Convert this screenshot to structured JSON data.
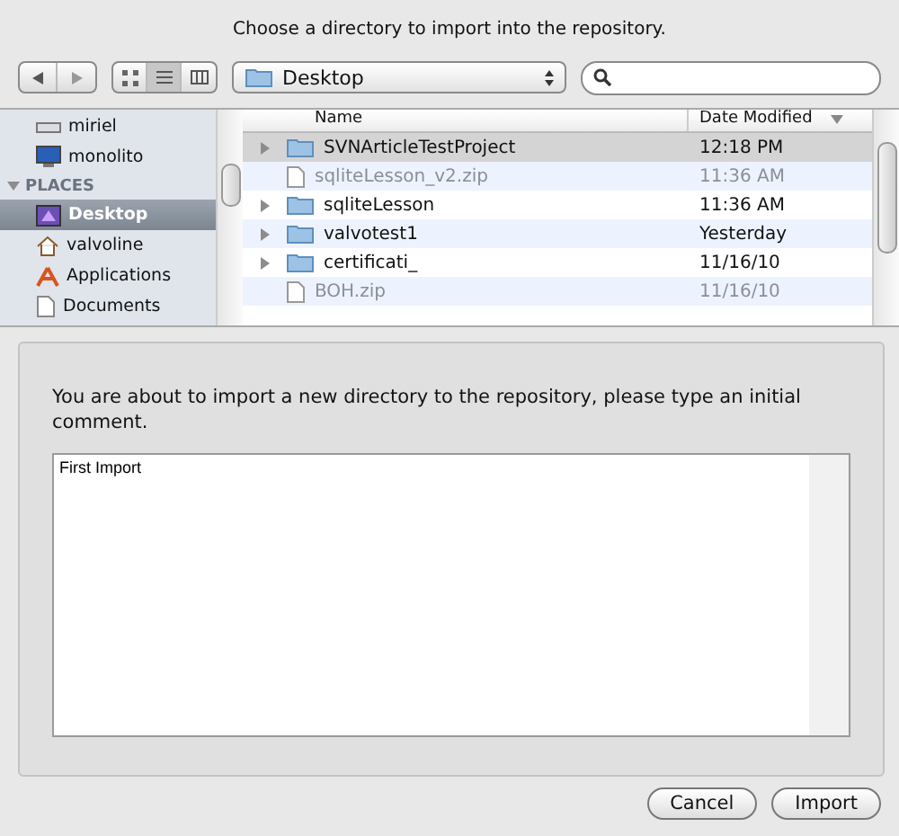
{
  "prompt": "Choose a directory to import into the repository.",
  "toolbar": {
    "views": [
      {
        "kind": "icons",
        "selected": false
      },
      {
        "kind": "list",
        "selected": true
      },
      {
        "kind": "columns",
        "selected": false
      }
    ],
    "location": "Desktop"
  },
  "sidebar": {
    "items": [
      {
        "kind": "drive",
        "label": "miriel",
        "selected": false
      },
      {
        "kind": "monitor",
        "label": "monolito",
        "selected": false
      },
      {
        "kind": "section",
        "label": "PLACES",
        "expanded": true
      },
      {
        "kind": "desktop",
        "label": "Desktop",
        "selected": true
      },
      {
        "kind": "home",
        "label": "valvoline",
        "selected": false
      },
      {
        "kind": "apps",
        "label": "Applications",
        "selected": false
      },
      {
        "kind": "doc",
        "label": "Documents",
        "selected": false
      }
    ]
  },
  "files": {
    "columns": [
      "Name",
      "Date Modified"
    ],
    "rows": [
      {
        "kind": "folder",
        "name": "SVNArticleTestProject",
        "date": "12:18 PM",
        "selected": true,
        "disabled": false
      },
      {
        "kind": "file",
        "name": "sqliteLesson_v2.zip",
        "date": "11:36 AM",
        "selected": false,
        "disabled": true
      },
      {
        "kind": "folder",
        "name": "sqliteLesson",
        "date": "11:36 AM",
        "selected": false,
        "disabled": false
      },
      {
        "kind": "folder",
        "name": "valvotest1",
        "date": "Yesterday",
        "selected": false,
        "disabled": false
      },
      {
        "kind": "folder",
        "name": "certificati_",
        "date": "11/16/10",
        "selected": false,
        "disabled": false
      },
      {
        "kind": "file",
        "name": "BOH.zip",
        "date": "11/16/10",
        "selected": false,
        "disabled": true
      }
    ]
  },
  "message": "You are about to import a new directory to the repository, please type an initial comment.",
  "comment": "First Import",
  "buttons": [
    "Cancel",
    "Import"
  ]
}
